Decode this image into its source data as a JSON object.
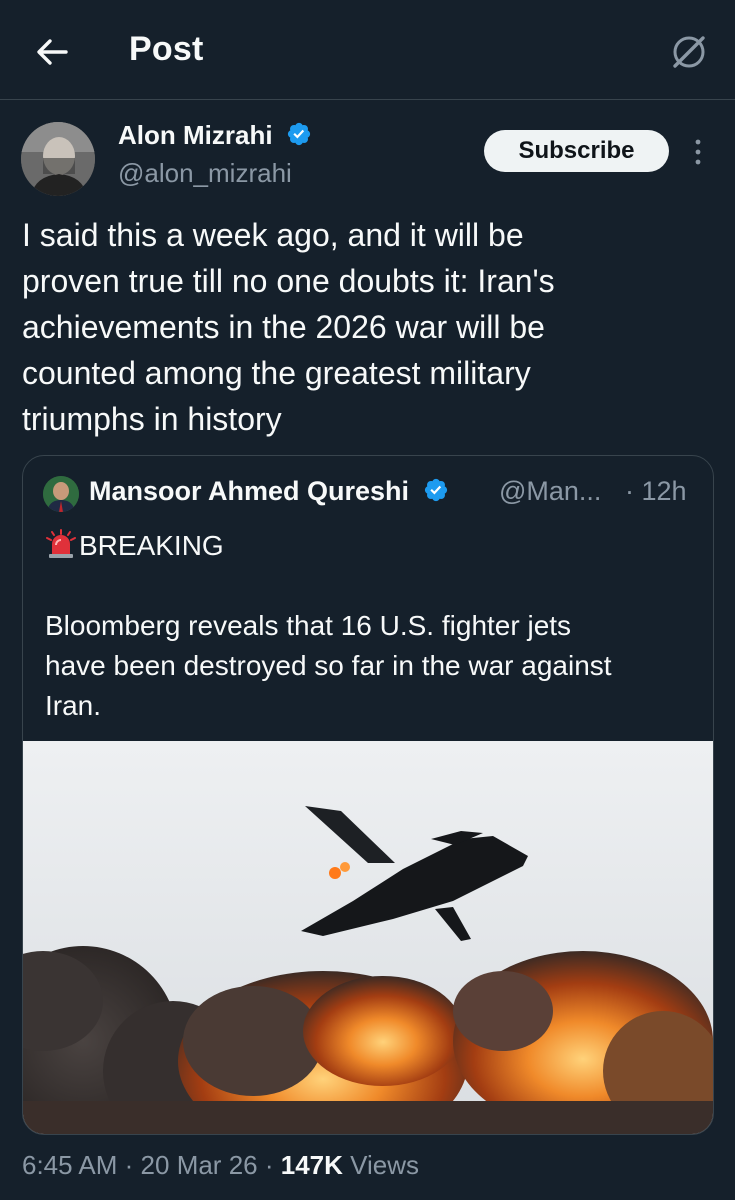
{
  "header": {
    "title": "Post"
  },
  "post": {
    "author_name": "Alon Mizrahi",
    "author_handle": "@alon_mizrahi",
    "subscribe_label": "Subscribe",
    "text_lines": [
      "I said this a week ago, and it will be",
      "proven true till no one doubts it: Iran's",
      "achievements in the 2026 war will be",
      "counted among the greatest military",
      "triumphs in history"
    ]
  },
  "quote": {
    "author_name": "Mansoor Ahmed Qureshi",
    "author_handle": "@Man...",
    "time": "· 12h",
    "headline": "BREAKING",
    "body_lines": [
      "Bloomberg reveals that 16 U.S. fighter jets",
      "have been destroyed so far in the war against",
      "Iran."
    ]
  },
  "meta": {
    "time": "6:45 AM",
    "date": "20 Mar 26",
    "views_count": "147K",
    "views_label": "Views",
    "separator": "·"
  },
  "colors": {
    "background": "#15202b",
    "border": "#38444d",
    "muted_text": "#8b98a5",
    "verified_blue": "#1d9bf0"
  },
  "icons": {
    "back": "arrow-left-icon",
    "grok": "grok-icon",
    "verified": "verified-badge-icon",
    "more": "more-vertical-icon",
    "siren": "siren-emoji-icon"
  }
}
